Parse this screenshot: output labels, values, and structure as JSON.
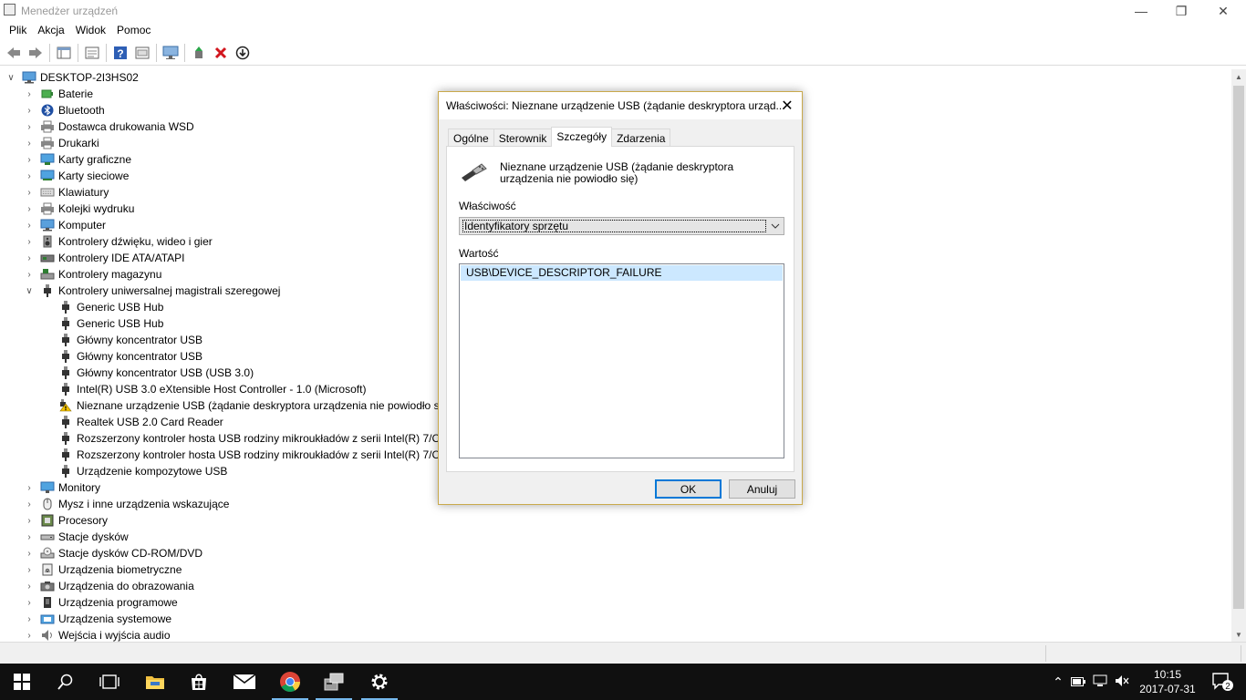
{
  "window": {
    "title": "Menedżer urządzeń",
    "minimize_glyph": "—",
    "restore_glyph": "❐",
    "close_glyph": "✕"
  },
  "menu": [
    "Plik",
    "Akcja",
    "Widok",
    "Pomoc"
  ],
  "toolbar_icons": [
    "back-icon",
    "forward-icon",
    "properties-view-icon",
    "console-icon",
    "help-icon",
    "show-hidden-icon",
    "scan-monitor-icon",
    "update-driver-icon",
    "uninstall-icon",
    "disable-device-icon"
  ],
  "tree": {
    "root": "DESKTOP-2I3HS02",
    "categories_top": [
      {
        "label": "Baterie",
        "icon": "battery-icon"
      },
      {
        "label": "Bluetooth",
        "icon": "bluetooth-icon"
      },
      {
        "label": "Dostawca drukowania WSD",
        "icon": "printer-icon"
      },
      {
        "label": "Drukarki",
        "icon": "printer-icon"
      },
      {
        "label": "Karty graficzne",
        "icon": "display-adapter-icon"
      },
      {
        "label": "Karty sieciowe",
        "icon": "network-adapter-icon"
      },
      {
        "label": "Klawiatury",
        "icon": "keyboard-icon"
      },
      {
        "label": "Kolejki wydruku",
        "icon": "printer-icon"
      },
      {
        "label": "Komputer",
        "icon": "computer-icon"
      },
      {
        "label": "Kontrolery dźwięku, wideo i gier",
        "icon": "speaker-icon"
      },
      {
        "label": "Kontrolery IDE ATA/ATAPI",
        "icon": "ide-controller-icon"
      },
      {
        "label": "Kontrolery magazynu",
        "icon": "storage-controller-icon"
      },
      {
        "label": "Kontrolery uniwersalnej magistrali szeregowej",
        "icon": "usb-icon"
      }
    ],
    "usb_children": [
      {
        "label": "Generic USB Hub",
        "warning": false
      },
      {
        "label": "Generic USB Hub",
        "warning": false
      },
      {
        "label": "Główny koncentrator USB",
        "warning": false
      },
      {
        "label": "Główny koncentrator USB",
        "warning": false
      },
      {
        "label": "Główny koncentrator USB (USB 3.0)",
        "warning": false
      },
      {
        "label": "Intel(R) USB 3.0 eXtensible Host Controller - 1.0 (Microsoft)",
        "warning": false
      },
      {
        "label": "Nieznane urządzenie USB (żądanie deskryptora urządzenia nie powiodło się)",
        "warning": true
      },
      {
        "label": "Realtek USB 2.0 Card Reader",
        "warning": false
      },
      {
        "label": "Rozszerzony kontroler hosta USB rodziny mikroukładów z serii Intel(R) 7/C21",
        "warning": false
      },
      {
        "label": "Rozszerzony kontroler hosta USB rodziny mikroukładów z serii Intel(R) 7/C21",
        "warning": false
      },
      {
        "label": "Urządzenie kompozytowe USB",
        "warning": false
      }
    ],
    "categories_bottom": [
      {
        "label": "Monitory",
        "icon": "monitor-icon"
      },
      {
        "label": "Mysz i inne urządzenia wskazujące",
        "icon": "mouse-icon"
      },
      {
        "label": "Procesory",
        "icon": "processor-icon"
      },
      {
        "label": "Stacje dysków",
        "icon": "disk-drive-icon"
      },
      {
        "label": "Stacje dysków CD-ROM/DVD",
        "icon": "cdrom-icon"
      },
      {
        "label": "Urządzenia biometryczne",
        "icon": "biometric-icon"
      },
      {
        "label": "Urządzenia do obrazowania",
        "icon": "camera-icon"
      },
      {
        "label": "Urządzenia programowe",
        "icon": "software-device-icon"
      },
      {
        "label": "Urządzenia systemowe",
        "icon": "system-device-icon"
      },
      {
        "label": "Wejścia i wyjścia audio",
        "icon": "audio-io-icon"
      }
    ]
  },
  "dialog": {
    "title": "Właściwości: Nieznane urządzenie USB (żądanie deskryptora urząd...",
    "tabs": [
      "Ogólne",
      "Sterownik",
      "Szczegóły",
      "Zdarzenia"
    ],
    "active_tab": "Szczegóły",
    "device_name": "Nieznane urządzenie USB (żądanie deskryptora urządzenia nie powiodło się)",
    "property_label": "Właściwość",
    "property_selected": "Identyfikatory sprzętu",
    "value_label": "Wartość",
    "values": [
      "USB\\DEVICE_DESCRIPTOR_FAILURE"
    ],
    "ok_label": "OK",
    "cancel_label": "Anuluj"
  },
  "taskbar": {
    "clock_time": "10:15",
    "clock_date": "2017-07-31",
    "notification_count": "2",
    "colors": {
      "background": "#101010",
      "accent": "#76b9ed"
    }
  }
}
